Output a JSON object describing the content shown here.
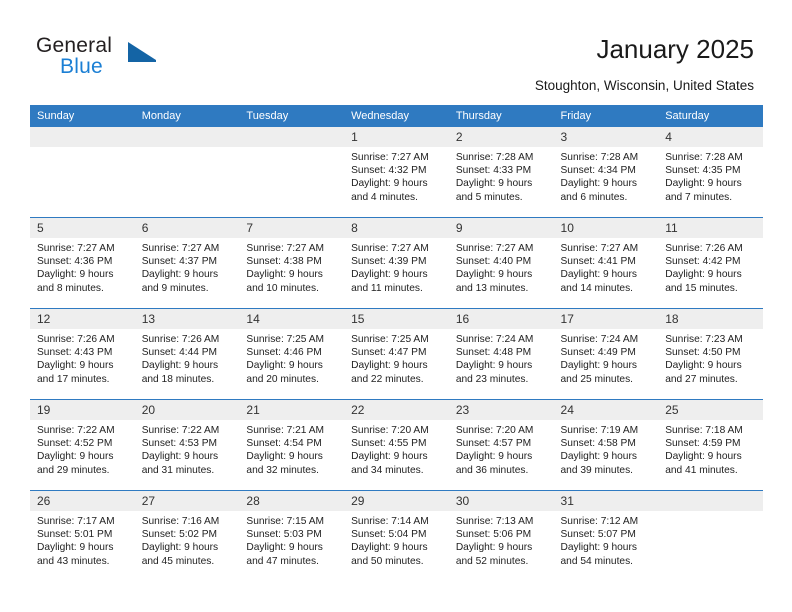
{
  "brand": {
    "name_top": "General",
    "name_bottom": "Blue",
    "accent_color": "#1464a5",
    "blue_text_color": "#1b7fd4"
  },
  "header": {
    "title": "January 2025",
    "subtitle": "Stoughton, Wisconsin, United States",
    "header_bg_color": "#2f7ac1"
  },
  "weekday_headers": [
    "Sunday",
    "Monday",
    "Tuesday",
    "Wednesday",
    "Thursday",
    "Friday",
    "Saturday"
  ],
  "labels": {
    "sunrise": "Sunrise:",
    "sunset": "Sunset:",
    "daylight": "Daylight:"
  },
  "weeks": [
    [
      {
        "day": "",
        "sunrise": "",
        "sunset": "",
        "daylight_line1": "",
        "daylight_line2": ""
      },
      {
        "day": "",
        "sunrise": "",
        "sunset": "",
        "daylight_line1": "",
        "daylight_line2": ""
      },
      {
        "day": "",
        "sunrise": "",
        "sunset": "",
        "daylight_line1": "",
        "daylight_line2": ""
      },
      {
        "day": "1",
        "sunrise": "Sunrise: 7:27 AM",
        "sunset": "Sunset: 4:32 PM",
        "daylight_line1": "Daylight: 9 hours",
        "daylight_line2": "and 4 minutes."
      },
      {
        "day": "2",
        "sunrise": "Sunrise: 7:28 AM",
        "sunset": "Sunset: 4:33 PM",
        "daylight_line1": "Daylight: 9 hours",
        "daylight_line2": "and 5 minutes."
      },
      {
        "day": "3",
        "sunrise": "Sunrise: 7:28 AM",
        "sunset": "Sunset: 4:34 PM",
        "daylight_line1": "Daylight: 9 hours",
        "daylight_line2": "and 6 minutes."
      },
      {
        "day": "4",
        "sunrise": "Sunrise: 7:28 AM",
        "sunset": "Sunset: 4:35 PM",
        "daylight_line1": "Daylight: 9 hours",
        "daylight_line2": "and 7 minutes."
      }
    ],
    [
      {
        "day": "5",
        "sunrise": "Sunrise: 7:27 AM",
        "sunset": "Sunset: 4:36 PM",
        "daylight_line1": "Daylight: 9 hours",
        "daylight_line2": "and 8 minutes."
      },
      {
        "day": "6",
        "sunrise": "Sunrise: 7:27 AM",
        "sunset": "Sunset: 4:37 PM",
        "daylight_line1": "Daylight: 9 hours",
        "daylight_line2": "and 9 minutes."
      },
      {
        "day": "7",
        "sunrise": "Sunrise: 7:27 AM",
        "sunset": "Sunset: 4:38 PM",
        "daylight_line1": "Daylight: 9 hours",
        "daylight_line2": "and 10 minutes."
      },
      {
        "day": "8",
        "sunrise": "Sunrise: 7:27 AM",
        "sunset": "Sunset: 4:39 PM",
        "daylight_line1": "Daylight: 9 hours",
        "daylight_line2": "and 11 minutes."
      },
      {
        "day": "9",
        "sunrise": "Sunrise: 7:27 AM",
        "sunset": "Sunset: 4:40 PM",
        "daylight_line1": "Daylight: 9 hours",
        "daylight_line2": "and 13 minutes."
      },
      {
        "day": "10",
        "sunrise": "Sunrise: 7:27 AM",
        "sunset": "Sunset: 4:41 PM",
        "daylight_line1": "Daylight: 9 hours",
        "daylight_line2": "and 14 minutes."
      },
      {
        "day": "11",
        "sunrise": "Sunrise: 7:26 AM",
        "sunset": "Sunset: 4:42 PM",
        "daylight_line1": "Daylight: 9 hours",
        "daylight_line2": "and 15 minutes."
      }
    ],
    [
      {
        "day": "12",
        "sunrise": "Sunrise: 7:26 AM",
        "sunset": "Sunset: 4:43 PM",
        "daylight_line1": "Daylight: 9 hours",
        "daylight_line2": "and 17 minutes."
      },
      {
        "day": "13",
        "sunrise": "Sunrise: 7:26 AM",
        "sunset": "Sunset: 4:44 PM",
        "daylight_line1": "Daylight: 9 hours",
        "daylight_line2": "and 18 minutes."
      },
      {
        "day": "14",
        "sunrise": "Sunrise: 7:25 AM",
        "sunset": "Sunset: 4:46 PM",
        "daylight_line1": "Daylight: 9 hours",
        "daylight_line2": "and 20 minutes."
      },
      {
        "day": "15",
        "sunrise": "Sunrise: 7:25 AM",
        "sunset": "Sunset: 4:47 PM",
        "daylight_line1": "Daylight: 9 hours",
        "daylight_line2": "and 22 minutes."
      },
      {
        "day": "16",
        "sunrise": "Sunrise: 7:24 AM",
        "sunset": "Sunset: 4:48 PM",
        "daylight_line1": "Daylight: 9 hours",
        "daylight_line2": "and 23 minutes."
      },
      {
        "day": "17",
        "sunrise": "Sunrise: 7:24 AM",
        "sunset": "Sunset: 4:49 PM",
        "daylight_line1": "Daylight: 9 hours",
        "daylight_line2": "and 25 minutes."
      },
      {
        "day": "18",
        "sunrise": "Sunrise: 7:23 AM",
        "sunset": "Sunset: 4:50 PM",
        "daylight_line1": "Daylight: 9 hours",
        "daylight_line2": "and 27 minutes."
      }
    ],
    [
      {
        "day": "19",
        "sunrise": "Sunrise: 7:22 AM",
        "sunset": "Sunset: 4:52 PM",
        "daylight_line1": "Daylight: 9 hours",
        "daylight_line2": "and 29 minutes."
      },
      {
        "day": "20",
        "sunrise": "Sunrise: 7:22 AM",
        "sunset": "Sunset: 4:53 PM",
        "daylight_line1": "Daylight: 9 hours",
        "daylight_line2": "and 31 minutes."
      },
      {
        "day": "21",
        "sunrise": "Sunrise: 7:21 AM",
        "sunset": "Sunset: 4:54 PM",
        "daylight_line1": "Daylight: 9 hours",
        "daylight_line2": "and 32 minutes."
      },
      {
        "day": "22",
        "sunrise": "Sunrise: 7:20 AM",
        "sunset": "Sunset: 4:55 PM",
        "daylight_line1": "Daylight: 9 hours",
        "daylight_line2": "and 34 minutes."
      },
      {
        "day": "23",
        "sunrise": "Sunrise: 7:20 AM",
        "sunset": "Sunset: 4:57 PM",
        "daylight_line1": "Daylight: 9 hours",
        "daylight_line2": "and 36 minutes."
      },
      {
        "day": "24",
        "sunrise": "Sunrise: 7:19 AM",
        "sunset": "Sunset: 4:58 PM",
        "daylight_line1": "Daylight: 9 hours",
        "daylight_line2": "and 39 minutes."
      },
      {
        "day": "25",
        "sunrise": "Sunrise: 7:18 AM",
        "sunset": "Sunset: 4:59 PM",
        "daylight_line1": "Daylight: 9 hours",
        "daylight_line2": "and 41 minutes."
      }
    ],
    [
      {
        "day": "26",
        "sunrise": "Sunrise: 7:17 AM",
        "sunset": "Sunset: 5:01 PM",
        "daylight_line1": "Daylight: 9 hours",
        "daylight_line2": "and 43 minutes."
      },
      {
        "day": "27",
        "sunrise": "Sunrise: 7:16 AM",
        "sunset": "Sunset: 5:02 PM",
        "daylight_line1": "Daylight: 9 hours",
        "daylight_line2": "and 45 minutes."
      },
      {
        "day": "28",
        "sunrise": "Sunrise: 7:15 AM",
        "sunset": "Sunset: 5:03 PM",
        "daylight_line1": "Daylight: 9 hours",
        "daylight_line2": "and 47 minutes."
      },
      {
        "day": "29",
        "sunrise": "Sunrise: 7:14 AM",
        "sunset": "Sunset: 5:04 PM",
        "daylight_line1": "Daylight: 9 hours",
        "daylight_line2": "and 50 minutes."
      },
      {
        "day": "30",
        "sunrise": "Sunrise: 7:13 AM",
        "sunset": "Sunset: 5:06 PM",
        "daylight_line1": "Daylight: 9 hours",
        "daylight_line2": "and 52 minutes."
      },
      {
        "day": "31",
        "sunrise": "Sunrise: 7:12 AM",
        "sunset": "Sunset: 5:07 PM",
        "daylight_line1": "Daylight: 9 hours",
        "daylight_line2": "and 54 minutes."
      },
      {
        "day": "",
        "sunrise": "",
        "sunset": "",
        "daylight_line1": "",
        "daylight_line2": ""
      }
    ]
  ]
}
